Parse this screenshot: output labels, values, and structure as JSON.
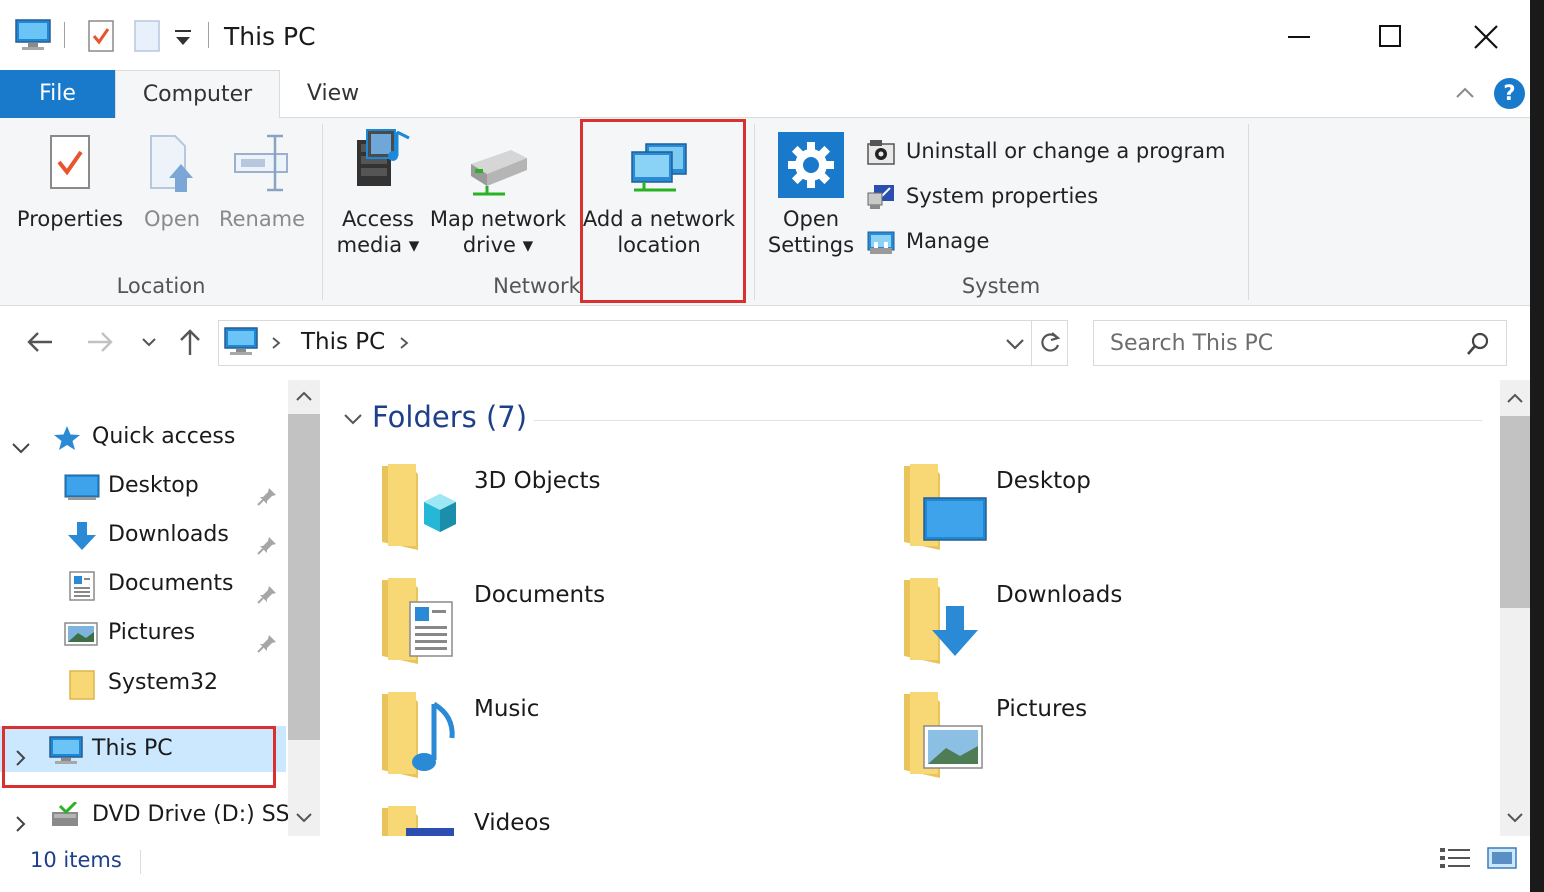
{
  "window": {
    "title": "This PC",
    "minimize_icon": "minimize-icon",
    "maximize_icon": "maximize-icon",
    "close_icon": "close-icon"
  },
  "ribbon_tabs": {
    "file": "File",
    "computer": "Computer",
    "view": "View",
    "help": "?"
  },
  "ribbon": {
    "location": {
      "label": "Location",
      "properties": "Properties",
      "open": "Open",
      "rename": "Rename"
    },
    "network": {
      "label": "Network",
      "access_media_1": "Access",
      "access_media_2": "media",
      "map_drive_1": "Map network",
      "map_drive_2": "drive",
      "add_location_1": "Add a network",
      "add_location_2": "location"
    },
    "system": {
      "label": "System",
      "open_settings_1": "Open",
      "open_settings_2": "Settings",
      "uninstall": "Uninstall or change a program",
      "system_properties": "System properties",
      "manage": "Manage"
    }
  },
  "address": {
    "path": "This PC",
    "search_placeholder": "Search This PC"
  },
  "nav_pane": {
    "quick_access": "Quick access",
    "items": [
      {
        "label": "Desktop"
      },
      {
        "label": "Downloads"
      },
      {
        "label": "Documents"
      },
      {
        "label": "Pictures"
      },
      {
        "label": "System32"
      }
    ],
    "this_pc": "This PC",
    "dvd_drive": "DVD Drive (D:) SSS"
  },
  "content": {
    "section": "Folders (7)",
    "folders": [
      {
        "name": "3D Objects"
      },
      {
        "name": "Desktop"
      },
      {
        "name": "Documents"
      },
      {
        "name": "Downloads"
      },
      {
        "name": "Music"
      },
      {
        "name": "Pictures"
      },
      {
        "name": "Videos"
      }
    ]
  },
  "status": {
    "items": "10 items"
  },
  "colors": {
    "accent": "#1979ca",
    "highlight": "#d93030",
    "selection": "#cce8ff",
    "section_text": "#1e3f8a"
  }
}
